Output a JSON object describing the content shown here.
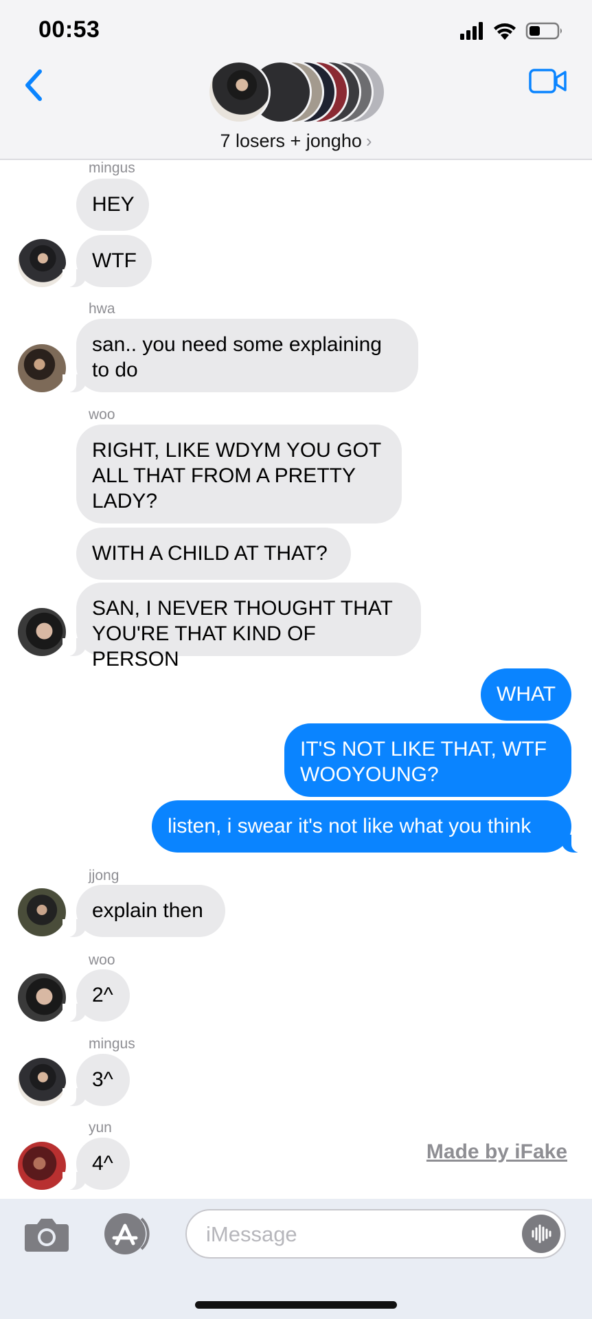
{
  "status_bar": {
    "time": "00:53"
  },
  "header": {
    "group_title": "7 losers + jongho",
    "chevron": "›"
  },
  "messages": {
    "m1": {
      "sender": "mingus",
      "text": "HEY"
    },
    "m2": {
      "text": "WTF"
    },
    "m3": {
      "sender": "hwa",
      "text": "san.. you need some explaining\nto do"
    },
    "m4": {
      "sender": "woo",
      "text": "RIGHT, LIKE WDYM YOU GOT\nALL THAT FROM A PRETTY\nLADY?"
    },
    "m5": {
      "text": "WITH A CHILD AT THAT?"
    },
    "m6": {
      "text": "SAN, I NEVER THOUGHT THAT\nYOU'RE THAT KIND OF PERSON"
    },
    "m7": {
      "text": "WHAT"
    },
    "m8": {
      "text": "IT'S NOT LIKE THAT, WTF\nWOOYOUNG?"
    },
    "m9": {
      "text": "listen, i swear it's not like what you think"
    },
    "m10": {
      "sender": "jjong",
      "text": "explain then"
    },
    "m11": {
      "sender": "woo",
      "text": "2^"
    },
    "m12": {
      "sender": "mingus",
      "text": "3^"
    },
    "m13": {
      "sender": "yun",
      "text": "4^"
    }
  },
  "watermark": "Made by iFake",
  "composer": {
    "placeholder": "iMessage"
  },
  "colors": {
    "accent": "#0a84ff",
    "incoming_bubble": "#e9e9eb",
    "header_bg": "#f4f4f6"
  },
  "icons": [
    "back-chevron-icon",
    "video-camera-icon",
    "camera-icon",
    "app-store-icon",
    "audio-waveform-icon",
    "signal-icon",
    "wifi-icon",
    "battery-icon"
  ]
}
